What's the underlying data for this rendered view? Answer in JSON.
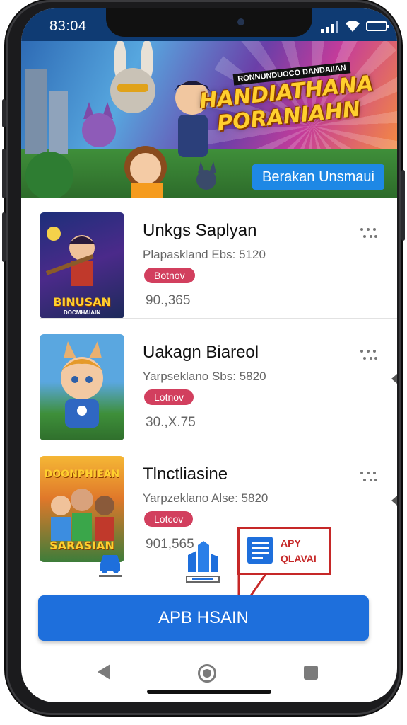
{
  "status_bar": {
    "time": "83:04"
  },
  "banner": {
    "small_title": "RONNUNDUOCO DANDAIIAN",
    "title": "HANDIATHANA PORANIAHN",
    "cta_label": "Berakan Unsmaui"
  },
  "games": [
    {
      "title": "Unkgs Saplyan",
      "subtitle": "Plapaskland Ebs: 5120",
      "badge": "Botnov",
      "price": "90.,365",
      "thumb_caption": "BINUSAN",
      "thumb_subcaption": "DOCMHAIAIN"
    },
    {
      "title": "Uakagn Biareol",
      "subtitle": "Yarpseklano Sbs: 5820",
      "badge": "Lotnov",
      "price": "30.,X.75",
      "thumb_caption": "",
      "thumb_subcaption": ""
    },
    {
      "title": "Tlnctliasine",
      "subtitle": "Yarpzeklano Alse: 5820",
      "badge": "Lotcov",
      "price": "901,565",
      "thumb_caption": "SARASIAN",
      "thumb_subcaption": "DOONPHIEAN"
    }
  ],
  "tooltip": {
    "line1": "APY",
    "line2": "QLAVAI"
  },
  "primary_button": {
    "label": "APB HSAIN"
  },
  "icons": {
    "tab_1": "car-icon",
    "tab_2": "city-icon",
    "more": "more-icon",
    "tooltip": "document-icon",
    "nav_back": "back-icon",
    "nav_home": "home-icon",
    "nav_recent": "recent-apps-icon"
  },
  "colors": {
    "accent": "#1e6fdc",
    "badge": "#d23f5e",
    "tooltip_border": "#c62828",
    "status_bar": "#0f3b73"
  }
}
